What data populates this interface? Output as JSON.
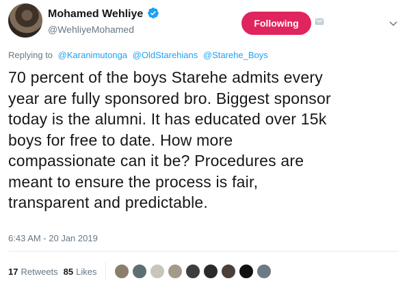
{
  "tweet": {
    "display_name": "Mohamed Wehliye",
    "handle": "@WehliyeMohamed",
    "follow_label": "Following",
    "reply_prefix": "Replying to",
    "reply_mentions": [
      "@Karanimutonga",
      "@OldStarehians",
      "@Starehe_Boys"
    ],
    "text": "70 percent of the boys Starehe admits every\nyear are fully sponsored bro. Biggest sponsor\ntoday is the alumni. It has educated over 15k\nboys for free to date. How more\ncompassionate can it be? Procedures are\nmeant to ensure the process is fair,\ntransparent and predictable.",
    "timestamp": "6:43 AM - 20 Jan 2019",
    "retweets_count": "17",
    "retweets_label": "Retweets",
    "likes_count": "85",
    "likes_label": "Likes"
  },
  "colors": {
    "follow_button": "#e0245e",
    "link": "#1da1f2",
    "verified": "#1da1f2",
    "muted": "#657786"
  },
  "icons": {
    "verified": "verified-badge-icon",
    "mail": "direct-message-icon",
    "menu": "chevron-down-icon"
  },
  "liker_avatars": [
    {
      "color": "#8a7f6a"
    },
    {
      "color": "#5c6f73"
    },
    {
      "color": "#c9c4bc"
    },
    {
      "color": "#a39a8c"
    },
    {
      "color": "#3d3d3d"
    },
    {
      "color": "#2a2a2a"
    },
    {
      "color": "#4a3f39"
    },
    {
      "color": "#111111"
    },
    {
      "color": "#6b7a84"
    }
  ]
}
